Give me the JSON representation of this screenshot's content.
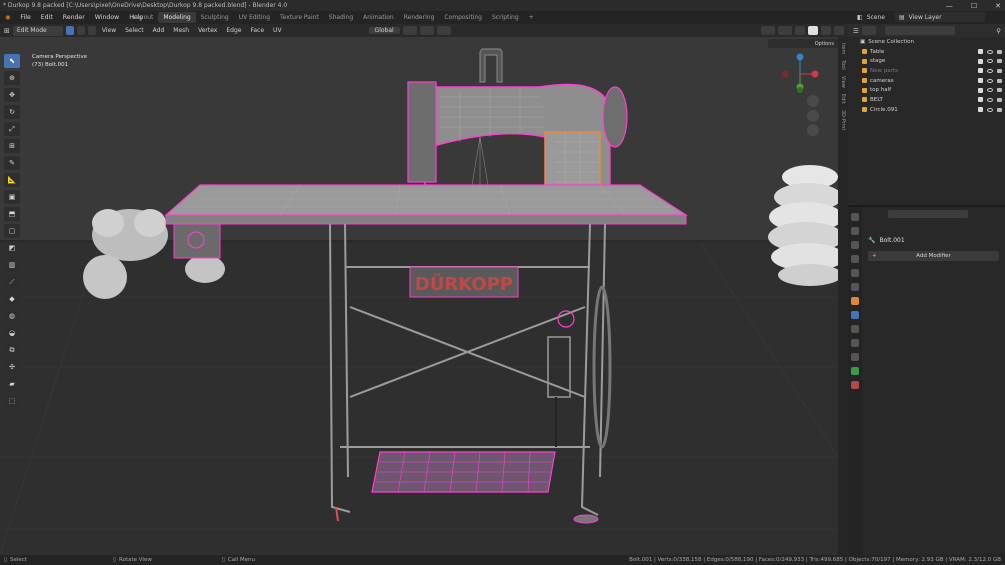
{
  "app": {
    "title": "* Durkop 9.8 packed [C:\\Users\\pixel\\OneDrive\\Desktop\\Durkop 9.8 packed.blend] - Blender 4.0"
  },
  "menu": [
    "File",
    "Edit",
    "Render",
    "Window",
    "Help"
  ],
  "workspaces": [
    "Layout",
    "Modeling",
    "Sculpting",
    "UV Editing",
    "Texture Paint",
    "Shading",
    "Animation",
    "Rendering",
    "Compositing",
    "Scripting"
  ],
  "active_workspace": "Modeling",
  "scene": {
    "label": "Scene"
  },
  "view_layer": {
    "label": "View Layer"
  },
  "header3d": {
    "mode": "Edit Mode",
    "menus": [
      "View",
      "Select",
      "Add",
      "Mesh",
      "Vertex",
      "Edge",
      "Face",
      "UV"
    ],
    "transform_orientation": "Global",
    "options_label": "Options"
  },
  "viewport": {
    "overlay_line1": "Camera Perspective",
    "overlay_line2": "(73) Bolt.001"
  },
  "side_tabs": [
    "Item",
    "Tool",
    "View",
    "Edit",
    "3D-Print"
  ],
  "outliner": {
    "title": "Scene Collection",
    "rows": [
      {
        "name": "Table",
        "dim": false
      },
      {
        "name": "stage",
        "dim": false
      },
      {
        "name": "New parts",
        "dim": true
      },
      {
        "name": "cameras",
        "dim": false
      },
      {
        "name": "top half",
        "dim": false
      },
      {
        "name": "BELT",
        "dim": false
      },
      {
        "name": "Circle.091",
        "dim": false
      }
    ]
  },
  "properties": {
    "object_name": "Bolt.001",
    "add_modifier": "Add Modifier"
  },
  "statusbar": {
    "select": "Select",
    "rotate": "Rotate View",
    "call_menu": "Call Menu",
    "stats": "Bolt.001 | Verts:0/338,158 | Edges:0/588,190 | Faces:0/249,933 | Tris:499,685 | Objects:70/197 | Memory: 2.93 GB | VRAM: 2.3/12.0 GB"
  },
  "colors": {
    "accent": "#4772b3",
    "select_edge": "#ff3fcf",
    "active_edge": "#ff8a2a"
  }
}
